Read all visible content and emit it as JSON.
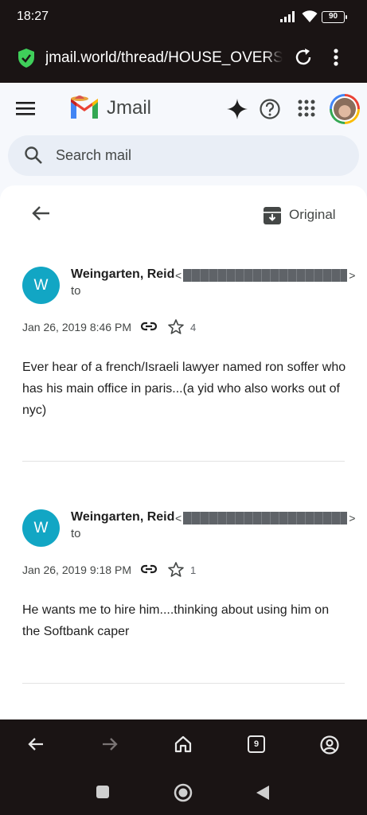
{
  "status_bar": {
    "time": "18:27",
    "battery": "90"
  },
  "browser": {
    "url": "jmail.world/thread/HOUSE_OVERSIGHT",
    "tab_count": "9"
  },
  "app": {
    "name": "Jmail",
    "search_placeholder": "Search mail",
    "original_label": "Original"
  },
  "messages": [
    {
      "avatar_letter": "W",
      "sender": "Weingarten, Reid",
      "addr_open": "<",
      "addr_close": ">",
      "to": "to",
      "date": "Jan 26, 2019 8:46 PM",
      "star_count": "4",
      "body": "Ever hear of a french/Israeli lawyer named ron soffer who has his main office in paris...(a yid who also works out of nyc)"
    },
    {
      "avatar_letter": "W",
      "sender": "Weingarten, Reid",
      "addr_open": "<",
      "addr_close": ">",
      "to": "to",
      "date": "Jan 26, 2019 9:18 PM",
      "star_count": "1",
      "body": "He wants me to hire him....thinking about using him on the Softbank caper"
    }
  ],
  "colors": {
    "avatar": "#12a6c4",
    "chrome": "#1a1414",
    "page_bg": "#f6f8fc",
    "search_bg": "#e9eef6"
  }
}
